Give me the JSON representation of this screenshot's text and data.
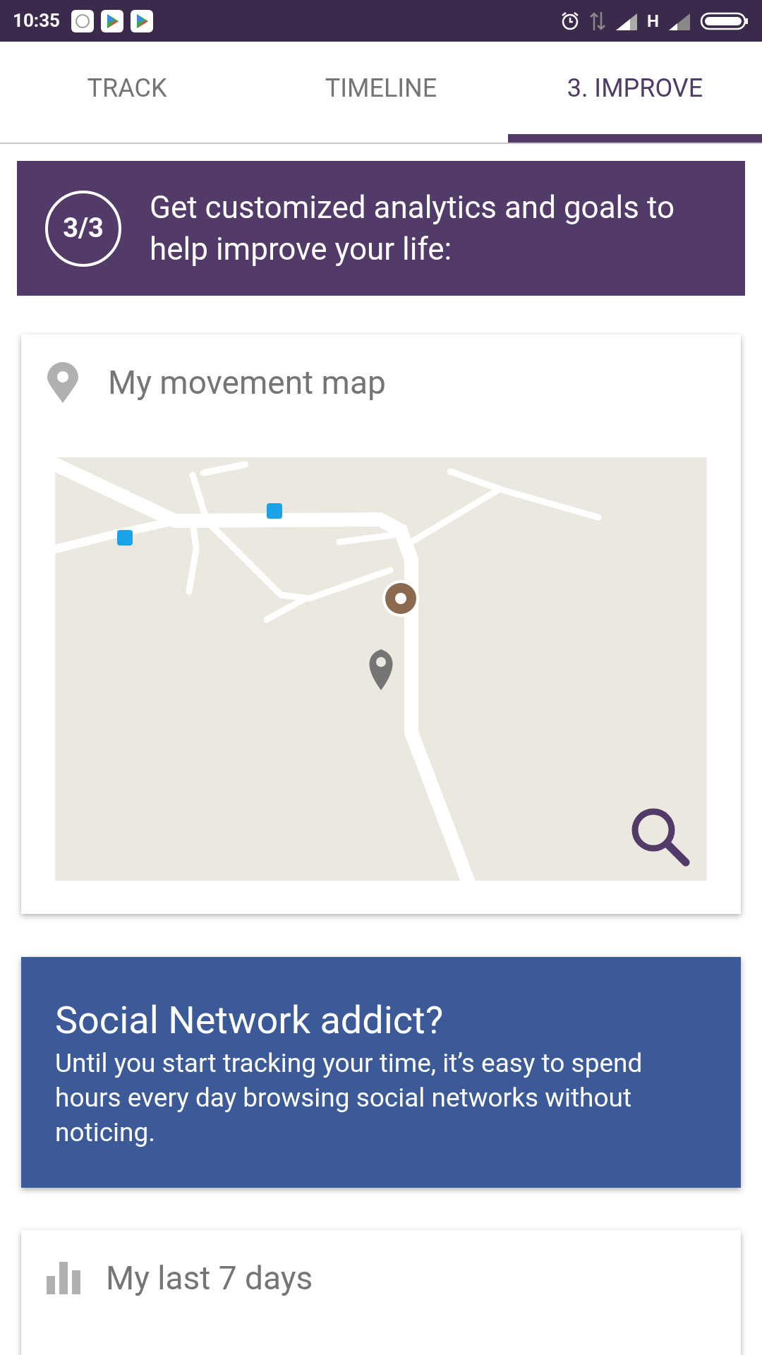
{
  "status_bar": {
    "time": "10:35",
    "network": "H"
  },
  "tabs": [
    {
      "label": "TRACK",
      "selected": false
    },
    {
      "label": "TIMELINE",
      "selected": false
    },
    {
      "label": "3. IMPROVE",
      "selected": true
    }
  ],
  "banner": {
    "step": "3/3",
    "text": "Get customized analytics and goals to help improve your life:"
  },
  "cards": [
    {
      "kind": "map",
      "title": "My movement map"
    },
    {
      "kind": "tip",
      "title": "Social Network addict?",
      "body": "Until you start tracking your time, it’s easy to spend hours every day browsing social networks without noticing."
    },
    {
      "kind": "chart",
      "title": "My last 7 days"
    }
  ]
}
